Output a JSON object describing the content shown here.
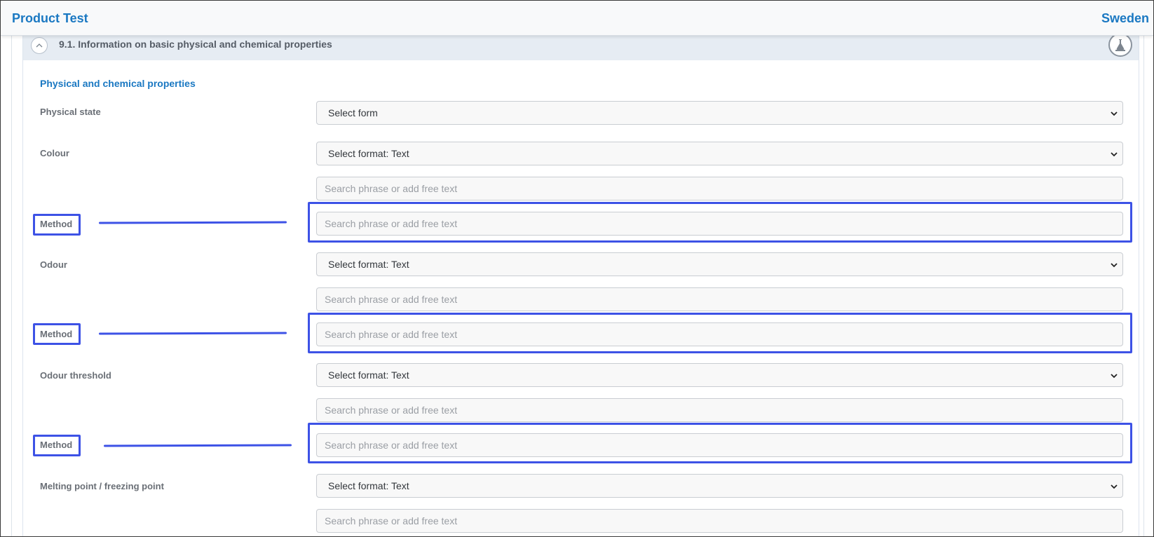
{
  "header": {
    "title": "Product Test",
    "country": "Sweden"
  },
  "section": {
    "title": "9.1. Information on basic physical and chemical properties",
    "collapse_icon": "chevron-up-icon",
    "tool_icon": "lab-flask-icon"
  },
  "subsection": {
    "title": "Physical and chemical properties"
  },
  "fields": {
    "physical_state": {
      "label": "Physical state",
      "select_value": "Select form"
    },
    "colour": {
      "label": "Colour",
      "select_value": "Select format: Text",
      "text_placeholder": "Search phrase or add free text"
    },
    "colour_method": {
      "label": "Method",
      "placeholder": "Search phrase or add free text"
    },
    "odour": {
      "label": "Odour",
      "select_value": "Select format: Text",
      "text_placeholder": "Search phrase or add free text"
    },
    "odour_method": {
      "label": "Method",
      "placeholder": "Search phrase or add free text"
    },
    "odour_threshold": {
      "label": "Odour threshold",
      "select_value": "Select format: Text",
      "text_placeholder": "Search phrase or add free text"
    },
    "odour_threshold_method": {
      "label": "Method",
      "placeholder": "Search phrase or add free text"
    },
    "melting_point": {
      "label": "Melting point / freezing point",
      "select_value": "Select format: Text",
      "text_placeholder": "Search phrase or add free text"
    }
  },
  "colors": {
    "brand": "#1a78c2",
    "annotation": "#3d52e6",
    "header_band": "#e6ecf3"
  }
}
